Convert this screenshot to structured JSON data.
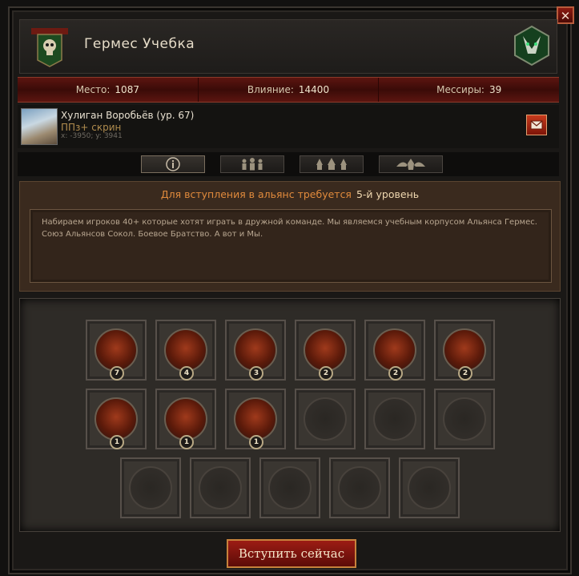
{
  "header": {
    "title": "Гермес Учебка",
    "close_label": "✕"
  },
  "stats": [
    {
      "label": "Место:",
      "value": "1087"
    },
    {
      "label": "Влияние:",
      "value": "14400"
    },
    {
      "label": "Мессиры:",
      "value": "39"
    }
  ],
  "leader": {
    "name": "Хулиган Воробьёв (ур. 67)",
    "subtitle": "ППз+ скрин",
    "coords": "x: -3950; y: 3941"
  },
  "tabs": [
    {
      "icon": "info-icon"
    },
    {
      "icon": "members-icon"
    },
    {
      "icon": "buildings-icon"
    },
    {
      "icon": "crest-icon"
    }
  ],
  "info": {
    "requirement_prefix": "Для вступления в альянс требуется",
    "requirement_value": "5-й уровень",
    "description": "Набираем игроков 40+ которые хотят играть в дружной команде. Мы являемся учебным корпусом Альянса Гермес. Союз Альянсов Сокол. Боевое Братство. А вот и Мы."
  },
  "slots": [
    {
      "count": "7"
    },
    {
      "count": "4"
    },
    {
      "count": "3"
    },
    {
      "count": "2"
    },
    {
      "count": "2"
    },
    {
      "count": "2"
    },
    {
      "count": "1"
    },
    {
      "count": "1"
    },
    {
      "count": "1"
    },
    {
      "count": null
    },
    {
      "count": null
    },
    {
      "count": null
    },
    {
      "count": null
    },
    {
      "count": null
    },
    {
      "count": null
    },
    {
      "count": null
    },
    {
      "count": null
    }
  ],
  "join_button": "Вступить сейчас"
}
